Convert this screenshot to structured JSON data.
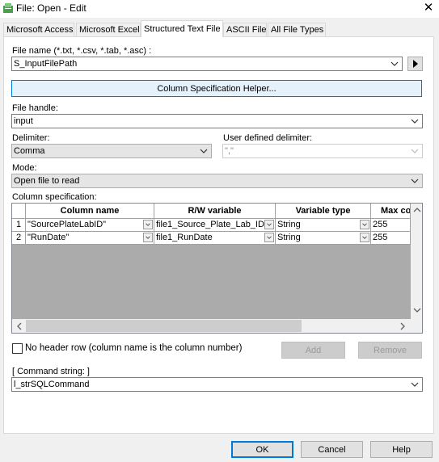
{
  "window": {
    "title": "File: Open - Edit",
    "close_glyph": "✕"
  },
  "tabs": [
    {
      "label": "Microsoft Access"
    },
    {
      "label": "Microsoft Excel"
    },
    {
      "label": "Structured Text File",
      "active": true
    },
    {
      "label": "ASCII File"
    },
    {
      "label": "All File Types"
    }
  ],
  "form": {
    "file_name_label": "File name (*.txt, *.csv, *.tab, *.asc) :",
    "file_name_value": "S_InputFilePath",
    "helper_button": "Column Specification Helper...",
    "file_handle_label": "File handle:",
    "file_handle_value": "input",
    "delimiter_label": "Delimiter:",
    "delimiter_value": "Comma",
    "user_delim_label": "User defined delimiter:",
    "user_delim_value": "\",\"",
    "mode_label": "Mode:",
    "mode_value": "Open file to read",
    "colspec_label": "Column specification:",
    "no_header_label": "No header row (column name is the column number)",
    "no_header_checked": false,
    "add_button": "Add",
    "remove_button": "Remove",
    "command_label": "[ Command string: ]",
    "command_value": "l_strSQLCommand"
  },
  "grid": {
    "headers": [
      "Column name",
      "R/W variable",
      "Variable type",
      "Max colu"
    ],
    "rows": [
      {
        "num": "1",
        "name": "\"SourcePlateLabID\"",
        "var": "file1_Source_Plate_Lab_ID",
        "type": "String",
        "max": "255"
      },
      {
        "num": "2",
        "name": "\"RunDate\"",
        "var": "file1_RunDate",
        "type": "String",
        "max": "255"
      }
    ]
  },
  "footer": {
    "ok": "OK",
    "cancel": "Cancel",
    "help": "Help"
  },
  "colors": {
    "accent": "#0078d7",
    "helper_bg": "#e5f1fb",
    "helper_border": "#0078d7"
  }
}
